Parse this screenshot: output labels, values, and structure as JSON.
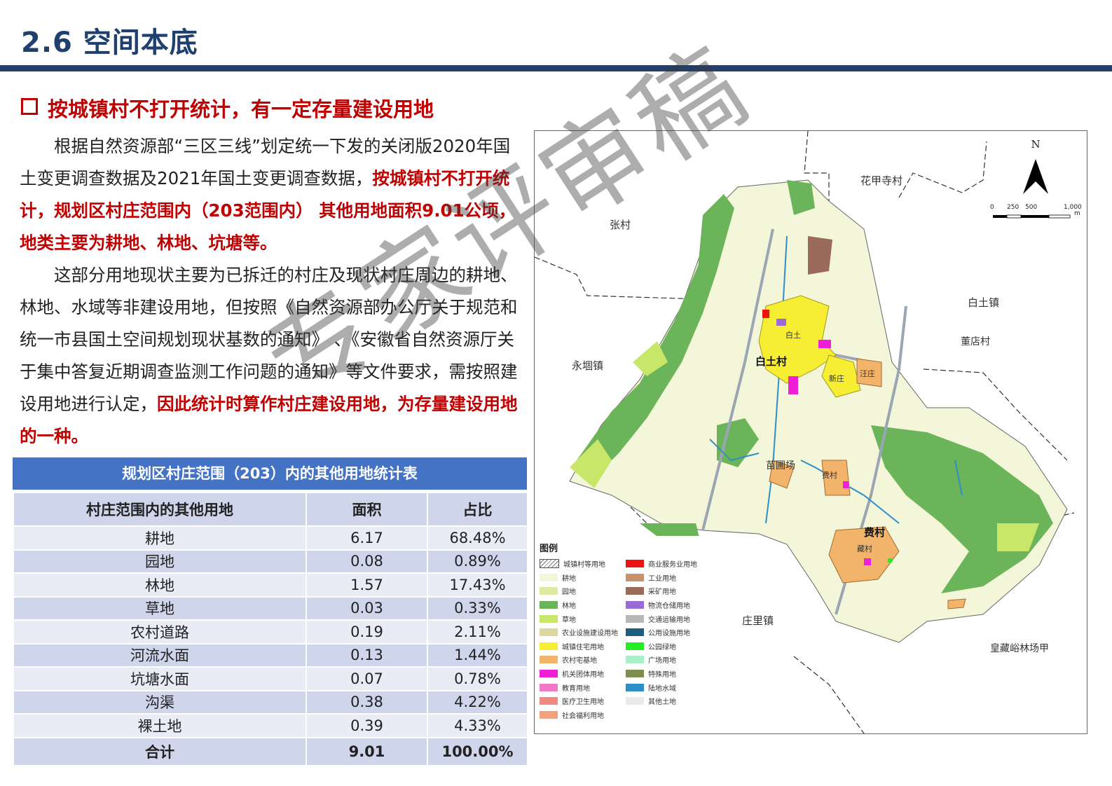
{
  "page": {
    "title": "2.6 空间本底"
  },
  "section": {
    "heading": "按城镇村不打开统计，有一定存量建设用地",
    "para1_a": "根据自然资源部“三区三线”划定统一下发的关闭版2020年国土变更调查数据及2021年国土变更调查数据，",
    "para1_b": "按城镇村不打开统计，规划区村庄范围内（203范围内） 其他用地面积9.01公顷，地类主要为耕地、林地、坑塘等。",
    "para2_a": "这部分用地现状主要为已拆迁的村庄及现状村庄周边的耕地、林地、水域等非建设用地，但按照《自然资源部办公厅关于规范和统一市县国土空间规划现状基数的通知》 、《安徽省自然资源厅关于集中答复近期调查监测工作问题的通知》等文件要求，需按照建设用地进行认定，",
    "para2_b": "因此统计时算作村庄建设用地，为存量建设用地的一种。"
  },
  "table": {
    "caption": "规划区村庄范围（203）内的其他用地统计表",
    "headers": [
      "村庄范围内的其他用地",
      "面积",
      "占比"
    ],
    "rows": [
      [
        "耕地",
        "6.17",
        "68.48%"
      ],
      [
        "园地",
        "0.08",
        "0.89%"
      ],
      [
        "林地",
        "1.57",
        "17.43%"
      ],
      [
        "草地",
        "0.03",
        "0.33%"
      ],
      [
        "农村道路",
        "0.19",
        "2.11%"
      ],
      [
        "河流水面",
        "0.13",
        "1.44%"
      ],
      [
        "坑塘水面",
        "0.07",
        "0.78%"
      ],
      [
        "沟渠",
        "0.38",
        "4.22%"
      ],
      [
        "裸土地",
        "0.39",
        "4.33%"
      ]
    ],
    "total": [
      "合计",
      "9.01",
      "100.00%"
    ]
  },
  "map": {
    "north": "N",
    "scale_labels": [
      "0",
      "250",
      "500",
      "1,000",
      "m"
    ],
    "places": {
      "huajiasi": "花甲寺村",
      "zhangcun": "张村",
      "baituzhen": "白土镇",
      "diandiancun": "董店村",
      "yongduzhen": "永堌镇",
      "baitucun": "白土村",
      "baitu_small": "白土",
      "xinzhuang": "新庄",
      "wangzhuang": "汪庄",
      "miaopu": "苗圃场",
      "feicun_small": "费村",
      "feicun": "费村",
      "zangcun": "藏村",
      "zhuanglizhen": "庄里镇",
      "huangcang": "皇藏峪林场甲"
    },
    "legend_title": "图例",
    "legend_left": [
      {
        "label": "城镇村等用地",
        "color": "#ffffff"
      },
      {
        "label": "耕地",
        "color": "#f3f6d8"
      },
      {
        "label": "园地",
        "color": "#dfeaa0"
      },
      {
        "label": "林地",
        "color": "#6cb45a"
      },
      {
        "label": "草地",
        "color": "#c8e66a"
      },
      {
        "label": "农业设施建设用地",
        "color": "#dcd9a0"
      },
      {
        "label": "城镇住宅用地",
        "color": "#f7ee33"
      },
      {
        "label": "农村宅基地",
        "color": "#f2b46b"
      },
      {
        "label": "机关团体用地",
        "color": "#ee1fd6"
      },
      {
        "label": "教育用地",
        "color": "#f07ac8"
      },
      {
        "label": "医疗卫生用地",
        "color": "#f08a80"
      },
      {
        "label": "社会福利用地",
        "color": "#f4a07a"
      }
    ],
    "legend_right": [
      {
        "label": "商业服务业用地",
        "color": "#ee1111"
      },
      {
        "label": "工业用地",
        "color": "#c8926a"
      },
      {
        "label": "采矿用地",
        "color": "#9a6a5a"
      },
      {
        "label": "物流仓储用地",
        "color": "#9a6ad8"
      },
      {
        "label": "交通运输用地",
        "color": "#b8b8b8"
      },
      {
        "label": "公用设施用地",
        "color": "#1e5e7e"
      },
      {
        "label": "公园绿地",
        "color": "#22ee22"
      },
      {
        "label": "广场用地",
        "color": "#a8f0c8"
      },
      {
        "label": "特殊用地",
        "color": "#7e8e4e"
      },
      {
        "label": "陆地水域",
        "color": "#2e8ec8"
      },
      {
        "label": "其他土地",
        "color": "#eaeaea"
      }
    ]
  },
  "watermark": "专家评审稿"
}
